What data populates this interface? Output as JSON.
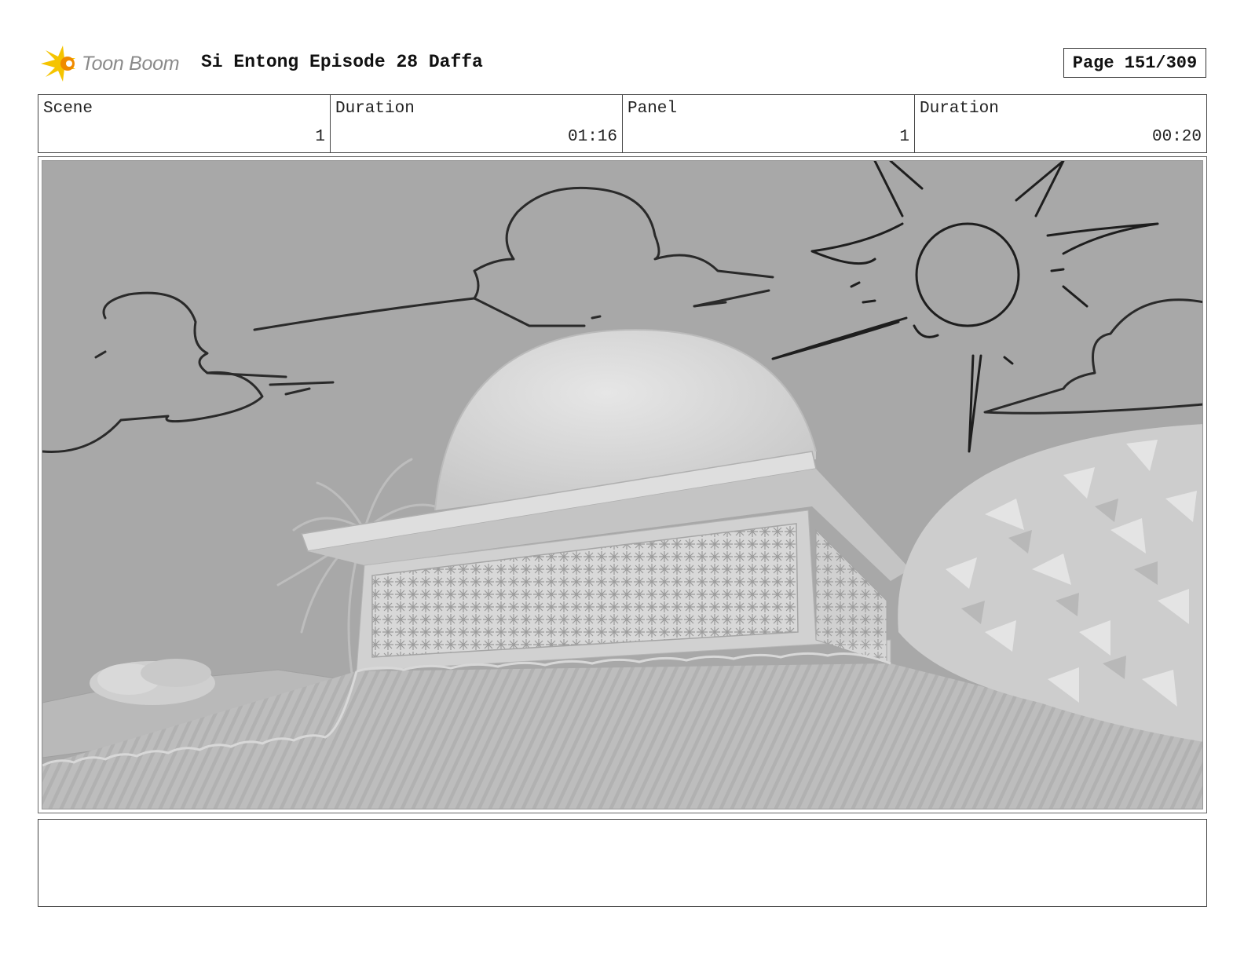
{
  "header": {
    "logo_text": "Toon Boom",
    "title": "Si Entong Episode 28 Daffa",
    "page": "Page 151/309"
  },
  "info": [
    {
      "label": "Scene",
      "value": "1"
    },
    {
      "label": "Duration",
      "value": "01:16"
    },
    {
      "label": "Panel",
      "value": "1"
    },
    {
      "label": "Duration",
      "value": "00:20"
    }
  ],
  "panel": {
    "scene_icons": [
      "cloud-icon",
      "sun-icon",
      "dome-icon",
      "palm-tree-icon",
      "bush-icon"
    ]
  },
  "notes": ""
}
